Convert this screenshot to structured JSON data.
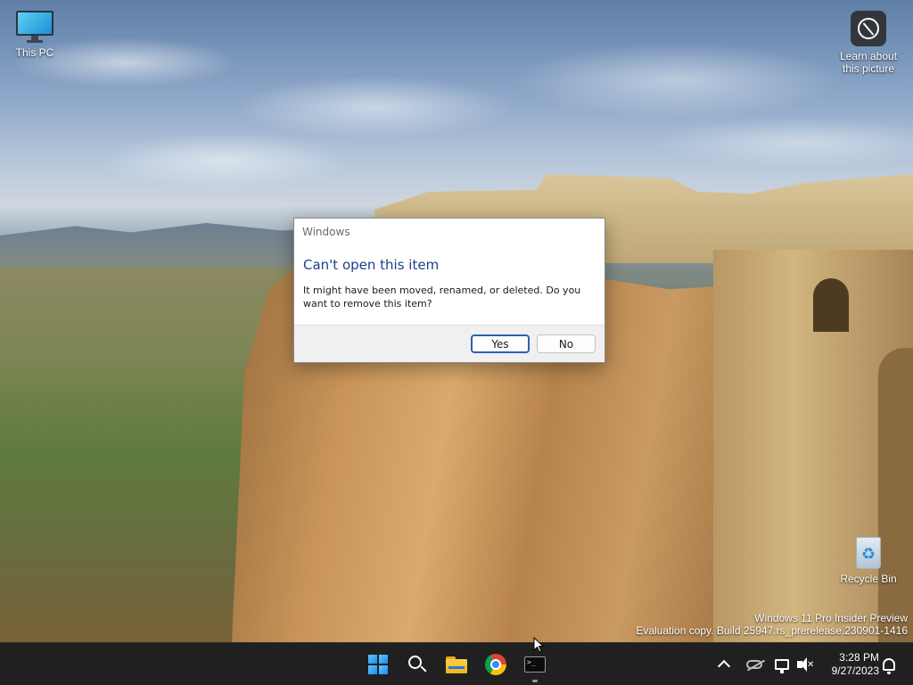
{
  "desktop": {
    "icons": [
      {
        "label": "This PC",
        "icon": "computer-icon"
      },
      {
        "label": "Learn about this picture",
        "icon": "learn-about-picture-icon"
      },
      {
        "label": "Recycle Bin",
        "icon": "recycle-bin-icon"
      }
    ],
    "watermark": {
      "line1": "Windows 11 Pro Insider Preview",
      "line2": "Evaluation copy. Build 25947.rs_prerelease.230901-1416"
    }
  },
  "dialog": {
    "title": "Windows",
    "heading": "Can't open this item",
    "message": "It might have been moved, renamed, or deleted. Do you want to remove this item?",
    "buttons": {
      "yes": "Yes",
      "no": "No"
    },
    "colors": {
      "heading": "#1e3e8c",
      "default_border": "#2f5fb3"
    }
  },
  "taskbar": {
    "pinned": [
      {
        "name": "Start",
        "icon": "windows-start-icon"
      },
      {
        "name": "Search",
        "icon": "search-icon"
      },
      {
        "name": "File Explorer",
        "icon": "folder-icon"
      },
      {
        "name": "Google Chrome",
        "icon": "chrome-icon"
      },
      {
        "name": "Terminal",
        "icon": "terminal-icon",
        "running": true
      }
    ],
    "tray": {
      "icons": [
        "show-hidden-icons-caret",
        "onedrive-icon",
        "network-icon",
        "volume-muted-icon",
        "notification-bell-icon"
      ],
      "time": "3:28 PM",
      "date": "9/27/2023"
    },
    "colors": {
      "background": "#202020"
    }
  }
}
